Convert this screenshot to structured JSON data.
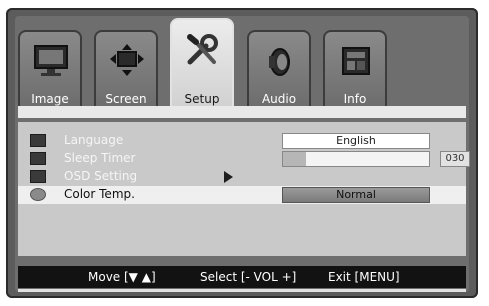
{
  "tabs": [
    {
      "label": "Image",
      "icon": "monitor-icon",
      "active": false
    },
    {
      "label": "Screen",
      "icon": "screen-arrows-icon",
      "active": false
    },
    {
      "label": "Setup",
      "icon": "tools-icon",
      "active": true
    },
    {
      "label": "Audio",
      "icon": "speaker-icon",
      "active": false
    },
    {
      "label": "Info",
      "icon": "info-icon",
      "active": false
    }
  ],
  "menu": {
    "language": {
      "label": "Language",
      "value": "English"
    },
    "sleep_timer": {
      "label": "Sleep Timer",
      "value": "030",
      "level": 0.16
    },
    "osd_setting": {
      "label": "OSD Setting"
    },
    "color_temp": {
      "label": "Color Temp.",
      "value": "Normal"
    }
  },
  "footer": {
    "move": "Move [▼ ▲]",
    "select": "Select [- VOL +]",
    "exit": "Exit [MENU]"
  }
}
